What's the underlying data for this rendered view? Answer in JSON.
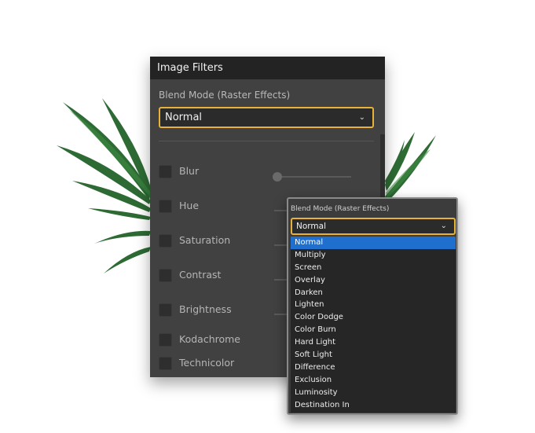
{
  "panel": {
    "title": "Image Filters",
    "blend_label": "Blend Mode (Raster Effects)",
    "blend_value": "Normal",
    "filters": [
      {
        "label": "Blur",
        "checked": false
      },
      {
        "label": "Hue",
        "checked": false
      },
      {
        "label": "Saturation",
        "checked": false
      },
      {
        "label": "Contrast",
        "checked": false
      },
      {
        "label": "Brightness",
        "checked": false
      },
      {
        "label": "Kodachrome",
        "checked": false
      },
      {
        "label": "Technicolor",
        "checked": false
      }
    ]
  },
  "popup": {
    "label": "Blend Mode (Raster Effects)",
    "value": "Normal",
    "options": [
      "Normal",
      "Multiply",
      "Screen",
      "Overlay",
      "Darken",
      "Lighten",
      "Color Dodge",
      "Color Burn",
      "Hard Light",
      "Soft Light",
      "Difference",
      "Exclusion",
      "Luminosity",
      "Destination In"
    ],
    "selected_index": 0
  },
  "icons": {
    "dropdown": "chevron-down-icon",
    "decoration": "palm-leaf-illustration"
  },
  "colors": {
    "accent": "#e8b13a",
    "selection": "#1f6fcf",
    "header": "#232323",
    "panel": "#414141"
  }
}
